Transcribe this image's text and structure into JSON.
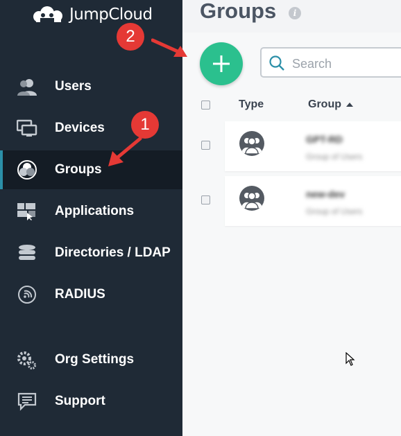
{
  "brand": {
    "name": "JumpCloud"
  },
  "sidebar": {
    "items": [
      {
        "label": "Users",
        "icon": "users-icon"
      },
      {
        "label": "Devices",
        "icon": "devices-icon"
      },
      {
        "label": "Groups",
        "icon": "groups-icon",
        "active": true
      },
      {
        "label": "Applications",
        "icon": "applications-icon"
      },
      {
        "label": "Directories / LDAP",
        "icon": "directories-icon"
      },
      {
        "label": "RADIUS",
        "icon": "radius-icon"
      },
      {
        "label": "Org Settings",
        "icon": "org-settings-icon"
      },
      {
        "label": "Support",
        "icon": "support-icon"
      }
    ]
  },
  "main": {
    "title": "Groups",
    "search": {
      "placeholder": "Search"
    },
    "table": {
      "columns": [
        "Type",
        "Group"
      ],
      "rows": [
        {
          "name": "GPT-RD",
          "type": "Group of Users"
        },
        {
          "name": "new-dev",
          "type": "Group of Users"
        }
      ]
    }
  },
  "annotations": [
    {
      "number": "1",
      "target": "Groups"
    },
    {
      "number": "2",
      "target": "Add group button"
    }
  ],
  "colors": {
    "sidebar": "#1f2a36",
    "accent": "#2bc08e",
    "active_bar": "#2b8fa8",
    "annotation": "#e53935"
  }
}
